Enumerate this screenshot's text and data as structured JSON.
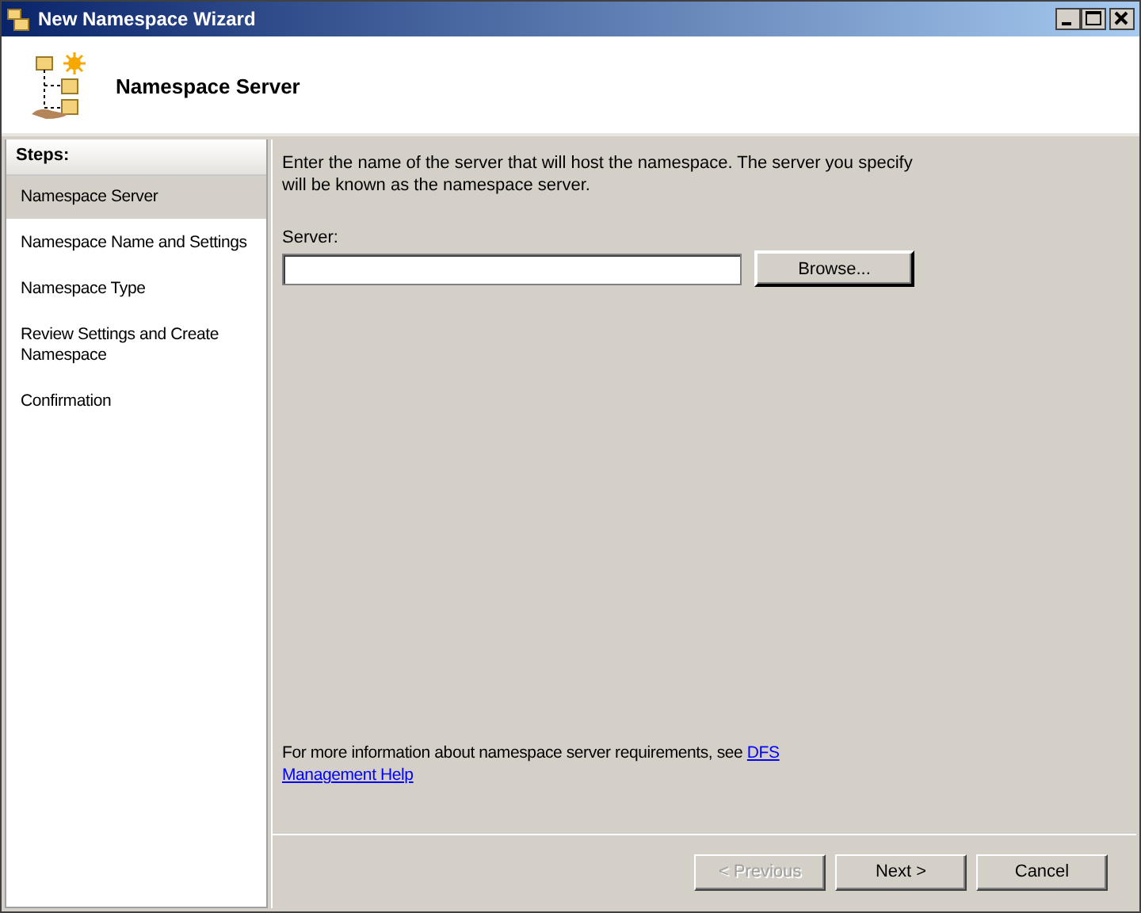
{
  "window": {
    "title": "New Namespace Wizard"
  },
  "header": {
    "title": "Namespace Server"
  },
  "steps": {
    "title": "Steps:",
    "items": [
      {
        "label": "Namespace Server",
        "selected": true
      },
      {
        "label": "Namespace Name and Settings",
        "selected": false
      },
      {
        "label": "Namespace Type",
        "selected": false
      },
      {
        "label": "Review Settings and Create Namespace",
        "selected": false
      },
      {
        "label": "Confirmation",
        "selected": false
      }
    ]
  },
  "instructions": "Enter the name of the server that will host the namespace. The server you specify will be known as the namespace server.",
  "server_field": {
    "label": "Server:"
  },
  "browse_button": "Browse...",
  "help": {
    "text": "For more information about namespace server requirements, see",
    "link_lines": [
      "DFS",
      "Management Help"
    ]
  },
  "buttons": [
    {
      "label": "< Previous",
      "disabled": true
    },
    {
      "label": "Next >",
      "disabled": false
    },
    {
      "label": "Cancel",
      "disabled": false
    }
  ]
}
